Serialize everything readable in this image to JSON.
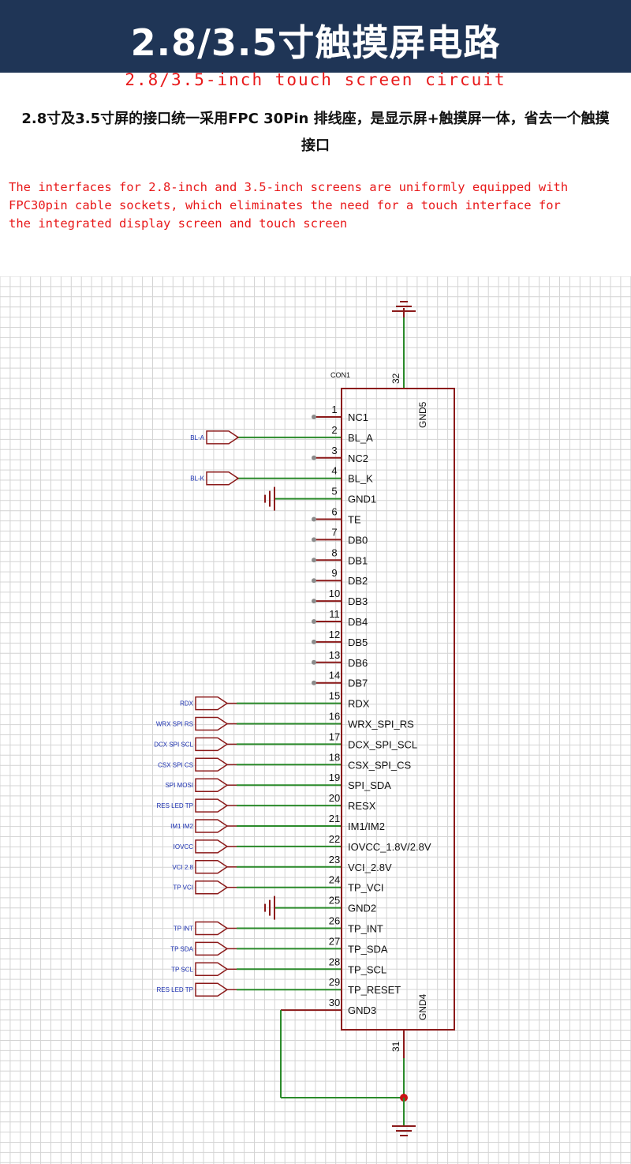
{
  "header": {
    "title": "2.8/3.5寸触摸屏电路"
  },
  "subtitle_en": "2.8/3.5-inch touch screen circuit",
  "description_cn": "2.8寸及3.5寸屏的接口统一采用FPC 30Pin 排线座，是显示屏+触摸屏一体，省去一个触摸接口",
  "description_en": "The interfaces for 2.8-inch and 3.5-inch screens are uniformly equipped with\nFPC30pin cable sockets, which eliminates the need for a touch interface for\nthe integrated display screen and touch screen",
  "schematic": {
    "component": "CON1",
    "right_pins": {
      "top": {
        "number": "32",
        "name": "GND5"
      },
      "bottom": {
        "number": "31",
        "name": "GND4"
      }
    },
    "pins": [
      {
        "number": "1",
        "name": "NC1",
        "conn": "nc"
      },
      {
        "number": "2",
        "name": "BL_A",
        "conn": "net",
        "net": "BL-A"
      },
      {
        "number": "3",
        "name": "NC2",
        "conn": "nc"
      },
      {
        "number": "4",
        "name": "BL_K",
        "conn": "net",
        "net": "BL-K"
      },
      {
        "number": "5",
        "name": "GND1",
        "conn": "gnd"
      },
      {
        "number": "6",
        "name": "TE",
        "conn": "nc"
      },
      {
        "number": "7",
        "name": "DB0",
        "conn": "nc"
      },
      {
        "number": "8",
        "name": "DB1",
        "conn": "nc"
      },
      {
        "number": "9",
        "name": "DB2",
        "conn": "nc"
      },
      {
        "number": "10",
        "name": "DB3",
        "conn": "nc"
      },
      {
        "number": "11",
        "name": "DB4",
        "conn": "nc"
      },
      {
        "number": "12",
        "name": "DB5",
        "conn": "nc"
      },
      {
        "number": "13",
        "name": "DB6",
        "conn": "nc"
      },
      {
        "number": "14",
        "name": "DB7",
        "conn": "nc"
      },
      {
        "number": "15",
        "name": "RDX",
        "conn": "net",
        "net": "RDX"
      },
      {
        "number": "16",
        "name": "WRX_SPI_RS",
        "conn": "net",
        "net": "WRX SPI RS"
      },
      {
        "number": "17",
        "name": "DCX_SPI_SCL",
        "conn": "net",
        "net": "DCX SPI SCL"
      },
      {
        "number": "18",
        "name": "CSX_SPI_CS",
        "conn": "net",
        "net": "CSX SPI CS"
      },
      {
        "number": "19",
        "name": "SPI_SDA",
        "conn": "net",
        "net": "SPI MOSI"
      },
      {
        "number": "20",
        "name": "RESX",
        "conn": "net",
        "net": "RES LED TP"
      },
      {
        "number": "21",
        "name": "IM1/IM2",
        "conn": "net",
        "net": "IM1 IM2"
      },
      {
        "number": "22",
        "name": "IOVCC_1.8V/2.8V",
        "conn": "net",
        "net": "IOVCC"
      },
      {
        "number": "23",
        "name": "VCI_2.8V",
        "conn": "net",
        "net": "VCI 2.8"
      },
      {
        "number": "24",
        "name": "TP_VCI",
        "conn": "net",
        "net": "TP VCI"
      },
      {
        "number": "25",
        "name": "GND2",
        "conn": "gnd"
      },
      {
        "number": "26",
        "name": "TP_INT",
        "conn": "net",
        "net": "TP INT"
      },
      {
        "number": "27",
        "name": "TP_SDA",
        "conn": "net",
        "net": "TP SDA"
      },
      {
        "number": "28",
        "name": "TP_SCL",
        "conn": "net",
        "net": "TP SCL"
      },
      {
        "number": "29",
        "name": "TP_RESET",
        "conn": "net",
        "net": "RES LED TP"
      },
      {
        "number": "30",
        "name": "GND3",
        "conn": "loop"
      }
    ],
    "colors": {
      "wire": "#2a8a2a",
      "body": "#8b1a1a",
      "net_label": "#1a2fb0",
      "grid": "#d4d4d4",
      "header_bg": "#1f3556",
      "accent_text": "#e8191a"
    }
  }
}
